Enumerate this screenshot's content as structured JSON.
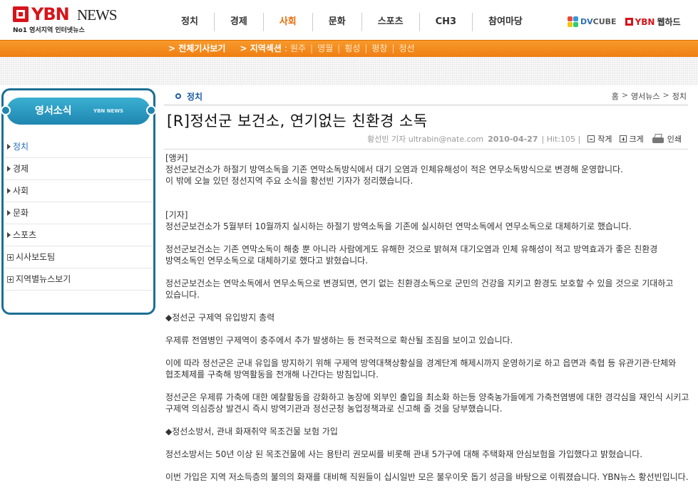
{
  "header": {
    "logo_ybn": "YBN",
    "logo_news": "NEWS",
    "tagline": "No1 영서지역 인터넷뉴스",
    "nav": [
      "정치",
      "경제",
      "사회",
      "문화",
      "스포츠",
      "CH3",
      "참여마당"
    ],
    "active_nav": "사회",
    "partner_dv": "DV",
    "partner_cube": "CUBE",
    "partner_ybn": "YBN",
    "partner_web": "웹하드"
  },
  "subnav": {
    "all_articles": "> 전체기사보기",
    "region_label": "> 지역섹션",
    "regions": [
      "원주",
      "영월",
      "횡성",
      "평창",
      "정선"
    ]
  },
  "sidebar": {
    "title": "영서소식",
    "subtitle": "YBN NEWS",
    "items": [
      {
        "label": "정치",
        "type": "arrow"
      },
      {
        "label": "경제",
        "type": "arrow"
      },
      {
        "label": "사회",
        "type": "arrow"
      },
      {
        "label": "문화",
        "type": "arrow"
      },
      {
        "label": "스포츠",
        "type": "arrow"
      },
      {
        "label": "시사보도팀",
        "type": "plus"
      },
      {
        "label": "지역별뉴스보기",
        "type": "plus"
      }
    ]
  },
  "article": {
    "category": "정치",
    "breadcrumb": [
      "홈",
      "영서뉴스",
      "정치"
    ],
    "title": "[R]정선군 보건소, 연기없는 친환경 소독",
    "author": "황선빈 기자 ultrabin@nate.com",
    "date": "2010-04-27",
    "hits": "| Hit:105 |",
    "small_label": "작게",
    "large_label": "크게",
    "print_label": "인쇄",
    "body": [
      "[앵커]",
      "정선군보건소가 하절기 방역소독을 기존 연막소독방식에서 대기 오염과 인체유해성이 적은 연무소독방식으로 변경해 운영합니다.",
      "이 밖에 오늘 있던 정선지역 주요 소식을 황선빈 기자가 정리했습니다.",
      "",
      "",
      "[기자]",
      "정선군보건소가 5월부터 10월까지 실시하는 하절기 방역소독을 기존에 실시하던 연막소독에서 연무소독으로 대체하기로 했습니다.",
      "",
      "정선군보건소는 기존 연막소독이 해충 뿐 아니라 사람에게도 유해한 것으로 밝혀져 대기오염과 인체 유해성이 적고 방역효과가 좋은 친환경 방역소독인 연무소독으로 대체하기로 했다고 밝혔습니다.",
      "",
      "정선군보건소는 연막소독에서 연무소독으로 변경되면, 연기 없는 친환경소독으로 군민의 건강을 지키고 환경도 보호할 수 있을 것으로 기대하고 있습니다.",
      "",
      "◆정선군 구제역 유입방지 총력",
      "",
      "우제류 전염병인 구제역이 충주에서 추가 발생하는 등 전국적으로 확산될 조짐을 보이고 있습니다.",
      "",
      "이에 따라 정선군은 군내 유입을 방지하기 위해 구제역 방역대책상황실을 경계단계 해제시까지 운영하기로 하고 읍면과 축협 등 유관기관·단체와 협조체제를 구축해 방역활동을 전개해 나간다는 방침입니다.",
      "",
      "정선군은 우제류 가축에 대한 예찰활동을 강화하고 농장에 외부인 출입을 최소화 하는등 양축농가들에게 가축전염병에 대한 경각심을 재인식 시키고 구제역 의심증상 발견시 즉시 방역기관과 정선군청 농업정책과로 신고해 줄 것을 당부했습니다.",
      "",
      "◆정선소방서, 관내 화재취약 목조건물 보험 가입",
      "",
      "정선소방서는 50년 이상 된 목조건물에 사는 용탄리 권모씨를 비롯해 관내 5가구에 대해 주택화재 안심보험을 가입했다고 밝혔습니다.",
      "",
      "이번 가입은 지역 저소득층의 불의의 화재를 대비해 직원들이 십시일반 모은 불우이웃 돕기 성금을 바탕으로 이뤄졌습니다. YBN뉴스 황선빈입니다."
    ]
  }
}
